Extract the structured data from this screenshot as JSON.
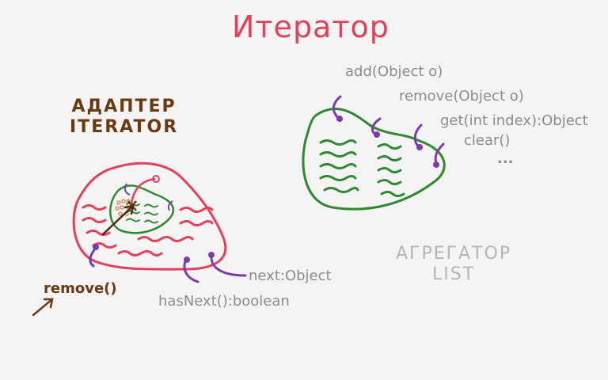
{
  "title": "Итератор",
  "adapter": {
    "line1": "АДАПТЕР",
    "line2": "ITERATOR"
  },
  "aggregator": {
    "line1": "АГРЕГАТОР",
    "line2": "LIST"
  },
  "list_methods": [
    "add(Object o)",
    "remove(Object o)",
    "get(int index):Object",
    "clear()",
    "..."
  ],
  "iterator_methods": {
    "next": "next:Object",
    "hasNext": "hasNext():boolean",
    "remove": "remove()"
  },
  "colors": {
    "title": "#e4405a",
    "adapter_label": "#6a3a10",
    "iterator_blob": "#e4405a",
    "list_blob": "#2f8a2f",
    "connector": "#7a3bb0",
    "method_text": "#8c8c8c",
    "arrow": "#6a3a10"
  }
}
